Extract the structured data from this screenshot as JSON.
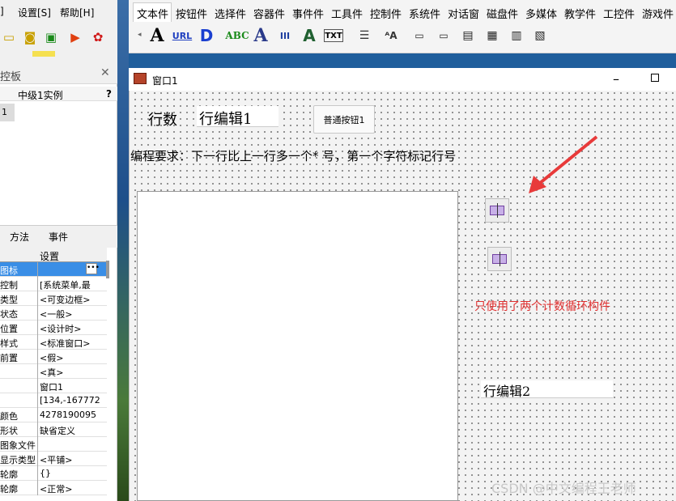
{
  "ide_menu": [
    "]",
    "设置[S]",
    "帮助[H]"
  ],
  "component_tabs": [
    "文本件",
    "按钮件",
    "选择件",
    "容器件",
    "事件件",
    "工具件",
    "控制件",
    "系统件",
    "对话窗",
    "磁盘件",
    "多媒体",
    "教学件",
    "工控件",
    "游戏件"
  ],
  "component_icons": [
    "A",
    "URL",
    "D",
    "ABC",
    "A",
    "III",
    "A",
    "TXT"
  ],
  "left_panel": {
    "title": "控板",
    "subtitle": "中级1实例",
    "help": "?",
    "selected_item": "1",
    "tabs": [
      "方法",
      "事件"
    ],
    "prop_header": "设置",
    "properties": [
      {
        "key": "图标",
        "value": ""
      },
      {
        "key": "控制",
        "value": "[系统菜单,最"
      },
      {
        "key": "类型",
        "value": "<可变边框>"
      },
      {
        "key": "状态",
        "value": "<一般>"
      },
      {
        "key": "位置",
        "value": "<设计时>"
      },
      {
        "key": "样式",
        "value": "<标准窗口>"
      },
      {
        "key": "前置",
        "value": "<假>"
      },
      {
        "key": "",
        "value": "<真>"
      },
      {
        "key": "",
        "value": "窗口1"
      },
      {
        "key": "",
        "value": "[134,-167772"
      },
      {
        "key": "颜色",
        "value": "4278190095"
      },
      {
        "key": "形状",
        "value": "缺省定义"
      },
      {
        "key": "图象文件",
        "value": ""
      },
      {
        "key": "显示类型",
        "value": "<平铺>"
      },
      {
        "key": "轮廓",
        "value": "{}"
      },
      {
        "key": "轮廓",
        "value": "<正常>"
      }
    ]
  },
  "window": {
    "title": "窗口1",
    "min_glyph": "–",
    "label_rows": "行数",
    "edit1": "行编辑1",
    "button1": "普通按钮1",
    "requirement": "编程要求：下一行比上一行多一个* 号，第一个字符标记行号",
    "note": "只使用了两个计数循环构件",
    "edit2": "行编辑2"
  },
  "watermark": "CSDN @中文编程王老师",
  "colors": {
    "note_red": "#e03030",
    "arrow_red": "#e83a3a",
    "selected_blue": "#3a8ee6"
  }
}
